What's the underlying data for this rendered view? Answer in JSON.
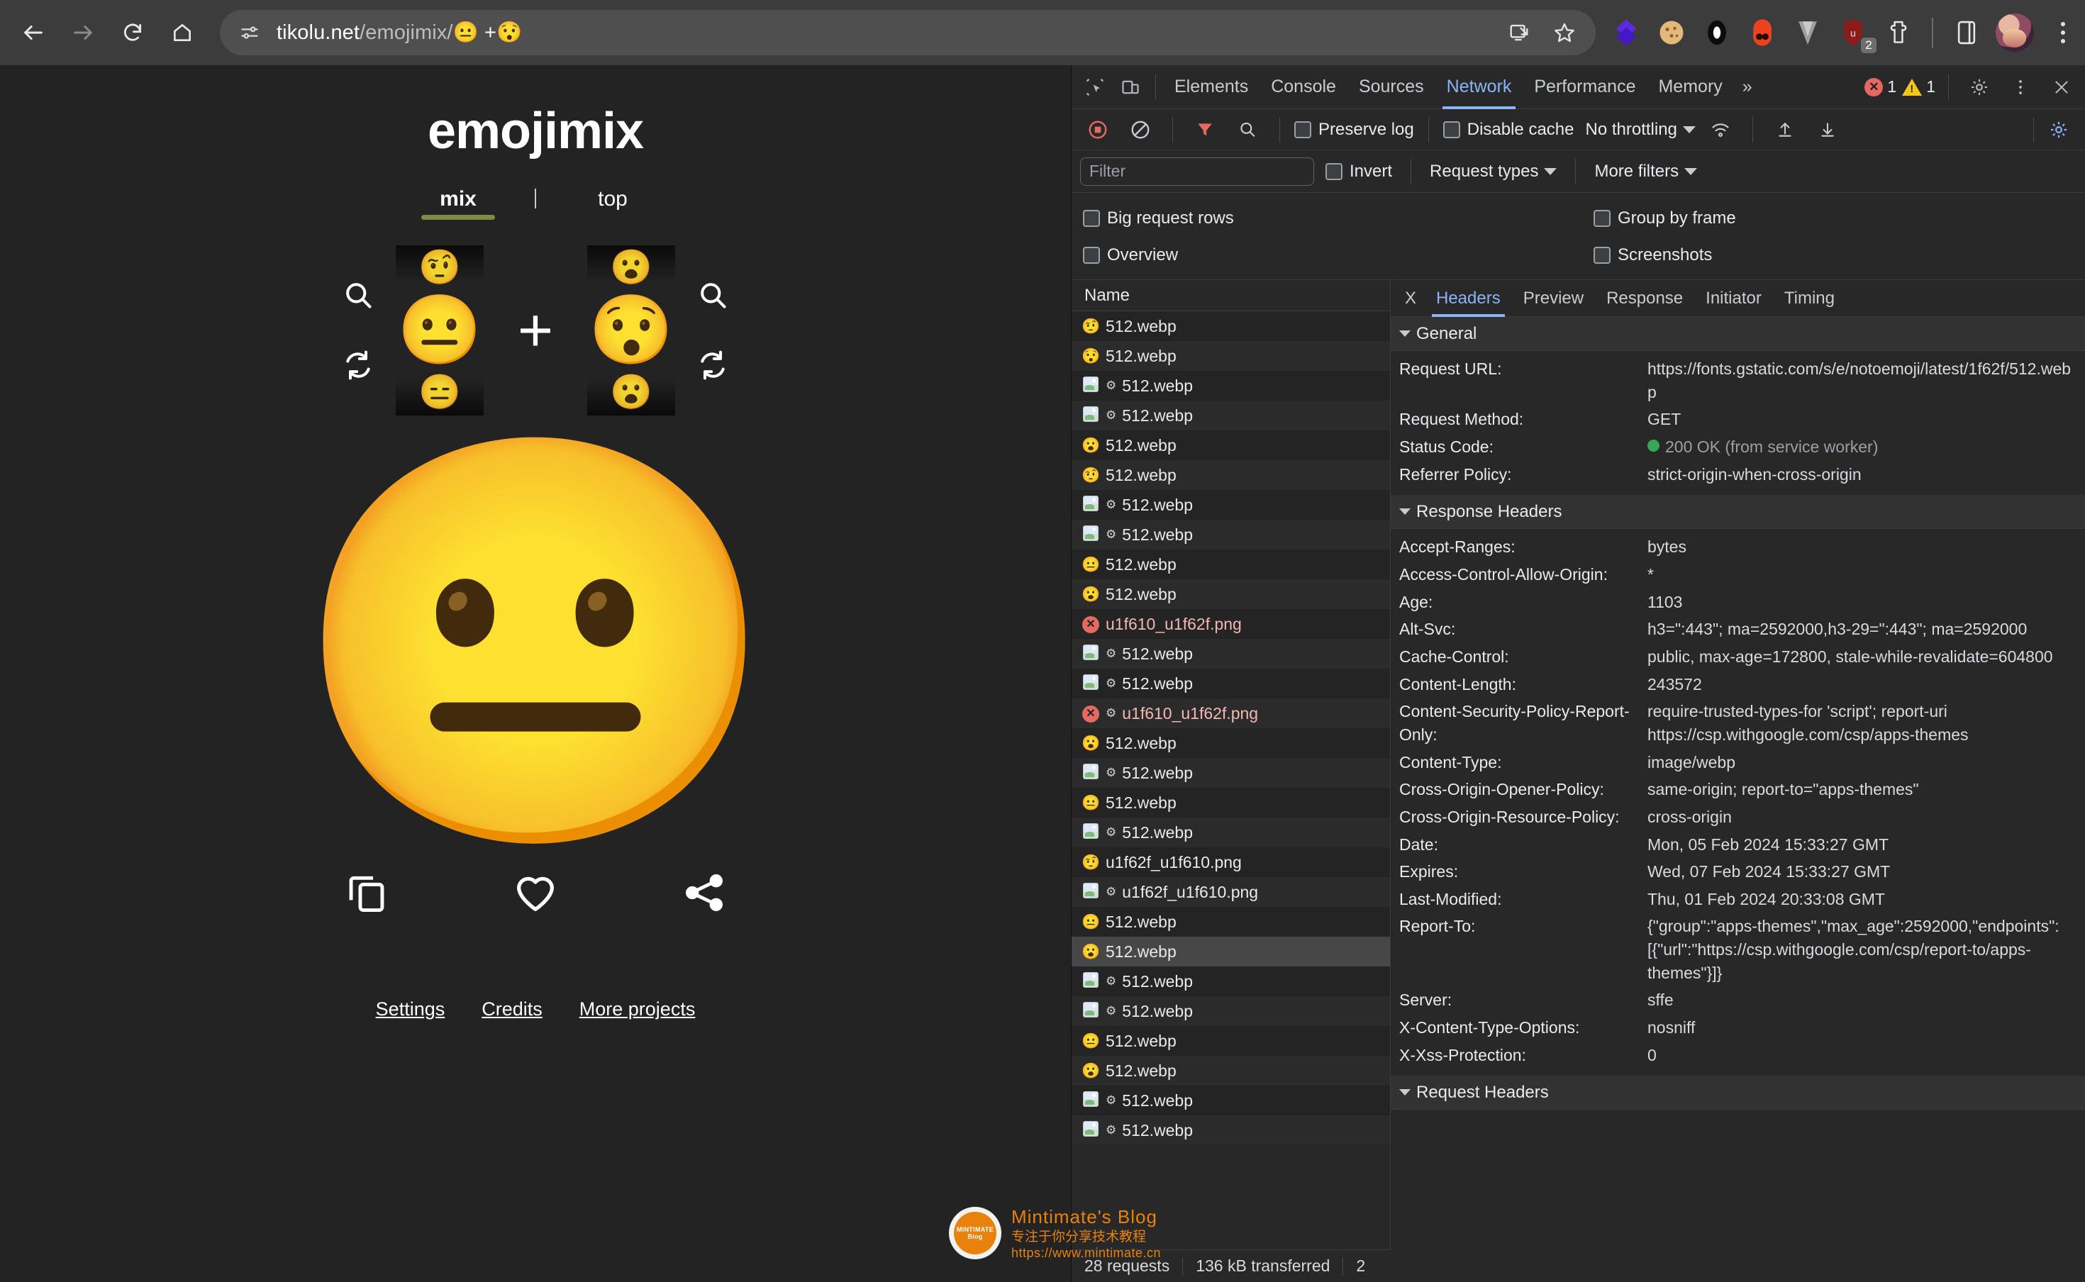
{
  "browser": {
    "back_label": "Back",
    "forward_label": "Forward",
    "reload_label": "Reload",
    "home_label": "Home",
    "site_info_label": "View site information",
    "url_prefix": "tikolu.net",
    "url_path": "/emojimix/",
    "url_emoji_a": "😐",
    "url_plus": "+",
    "url_emoji_b": "😯",
    "install_label": "Install page as app",
    "bookmark_label": "Bookmark this tab",
    "extensions": [
      {
        "name": "diamond-extension-icon",
        "badge": ""
      },
      {
        "name": "cookie-extension-icon",
        "badge": ""
      },
      {
        "name": "ring-extension-icon",
        "badge": ""
      },
      {
        "name": "red-extension-icon",
        "badge": ""
      },
      {
        "name": "v-extension-icon",
        "badge": ""
      },
      {
        "name": "shield-extension-icon",
        "badge": "2"
      },
      {
        "name": "puzzle-extensions-icon",
        "badge": ""
      }
    ],
    "side_panel_label": "Side panel",
    "profile_label": "Profile",
    "menu_label": "Customize and control Google Chrome"
  },
  "page": {
    "title": "emojimix",
    "tabs": [
      {
        "label": "mix",
        "active": true
      },
      {
        "label": "top",
        "active": false
      }
    ],
    "left_picker": {
      "search_label": "search-icon",
      "shuffle_label": "shuffle-icon",
      "prev_emoji": "🤨",
      "current_emoji": "😐",
      "next_emoji": "😑"
    },
    "plus": "+",
    "right_picker": {
      "search_label": "search-icon",
      "shuffle_label": "shuffle-icon",
      "prev_emoji": "😮",
      "current_emoji": "😯",
      "next_emoji": "😮"
    },
    "result_emoji": "😐",
    "actions": [
      {
        "name": "copy-button",
        "label": "Copy"
      },
      {
        "name": "favorite-button",
        "label": "Favorite"
      },
      {
        "name": "share-button",
        "label": "Share"
      }
    ],
    "footer_links": [
      "Settings",
      "Credits",
      "More projects"
    ]
  },
  "watermark": {
    "logo_line1": "MINTIMATE",
    "logo_line2": "Blog",
    "title": "Mintimate's Blog",
    "subtitle": "专注于你分享技术教程",
    "url": "https://www.mintimate.cn"
  },
  "devtools": {
    "inspect_label": "inspect-element-icon",
    "device_label": "device-toolbar-icon",
    "tabs": [
      {
        "label": "Elements",
        "active": false
      },
      {
        "label": "Console",
        "active": false
      },
      {
        "label": "Sources",
        "active": false
      },
      {
        "label": "Network",
        "active": true
      },
      {
        "label": "Performance",
        "active": false
      },
      {
        "label": "Memory",
        "active": false
      }
    ],
    "more_tabs": "»",
    "error_count": "1",
    "warning_count": "1",
    "settings_label": "settings-gear-icon",
    "kebab_label": "more-options-icon",
    "close_label": "close-devtools-icon",
    "network_toolbar": {
      "record_label": "record-stop-icon",
      "clear_label": "clear-icon",
      "filter_toggle_label": "filter-icon",
      "search_label": "search-icon",
      "preserve_log": "Preserve log",
      "disable_cache": "Disable cache",
      "throttling": "No throttling",
      "wifi_label": "network-conditions-icon",
      "import_label": "import-har-icon",
      "export_label": "export-har-icon",
      "gear_label": "network-settings-icon"
    },
    "filter_bar": {
      "filter_placeholder": "Filter",
      "filter_value": "",
      "invert": "Invert",
      "request_types": "Request types",
      "more_filters": "More filters"
    },
    "options": {
      "big_request_rows": "Big request rows",
      "group_by_frame": "Group by frame",
      "overview": "Overview",
      "screenshots": "Screenshots"
    },
    "request_column_header": "Name",
    "requests": [
      {
        "icon": "emoji",
        "emoji": "🤨",
        "gear": false,
        "name": "512.webp",
        "error": false,
        "selected": false
      },
      {
        "icon": "emoji",
        "emoji": "😯",
        "gear": false,
        "name": "512.webp",
        "error": false,
        "selected": false
      },
      {
        "icon": "image",
        "emoji": "",
        "gear": true,
        "name": "512.webp",
        "error": false,
        "selected": false
      },
      {
        "icon": "image",
        "emoji": "",
        "gear": true,
        "name": "512.webp",
        "error": false,
        "selected": false
      },
      {
        "icon": "emoji",
        "emoji": "😮",
        "gear": false,
        "name": "512.webp",
        "error": false,
        "selected": false
      },
      {
        "icon": "emoji",
        "emoji": "🤨",
        "gear": false,
        "name": "512.webp",
        "error": false,
        "selected": false
      },
      {
        "icon": "image",
        "emoji": "",
        "gear": true,
        "name": "512.webp",
        "error": false,
        "selected": false
      },
      {
        "icon": "image",
        "emoji": "",
        "gear": true,
        "name": "512.webp",
        "error": false,
        "selected": false
      },
      {
        "icon": "emoji",
        "emoji": "😐",
        "gear": false,
        "name": "512.webp",
        "error": false,
        "selected": false
      },
      {
        "icon": "emoji",
        "emoji": "😮",
        "gear": false,
        "name": "512.webp",
        "error": false,
        "selected": false
      },
      {
        "icon": "error",
        "emoji": "",
        "gear": false,
        "name": "u1f610_u1f62f.png",
        "error": true,
        "selected": false
      },
      {
        "icon": "image",
        "emoji": "",
        "gear": true,
        "name": "512.webp",
        "error": false,
        "selected": false
      },
      {
        "icon": "image",
        "emoji": "",
        "gear": true,
        "name": "512.webp",
        "error": false,
        "selected": false
      },
      {
        "icon": "error",
        "emoji": "",
        "gear": true,
        "name": "u1f610_u1f62f.png",
        "error": true,
        "selected": false
      },
      {
        "icon": "emoji",
        "emoji": "😮",
        "gear": false,
        "name": "512.webp",
        "error": false,
        "selected": false
      },
      {
        "icon": "image",
        "emoji": "",
        "gear": true,
        "name": "512.webp",
        "error": false,
        "selected": false
      },
      {
        "icon": "emoji",
        "emoji": "😐",
        "gear": false,
        "name": "512.webp",
        "error": false,
        "selected": false
      },
      {
        "icon": "image",
        "emoji": "",
        "gear": true,
        "name": "512.webp",
        "error": false,
        "selected": false
      },
      {
        "icon": "emoji",
        "emoji": "🤨",
        "gear": false,
        "name": "u1f62f_u1f610.png",
        "error": false,
        "selected": false
      },
      {
        "icon": "image",
        "emoji": "",
        "gear": true,
        "name": "u1f62f_u1f610.png",
        "error": false,
        "selected": false
      },
      {
        "icon": "emoji",
        "emoji": "😐",
        "gear": false,
        "name": "512.webp",
        "error": false,
        "selected": false
      },
      {
        "icon": "emoji",
        "emoji": "😮",
        "gear": false,
        "name": "512.webp",
        "error": false,
        "selected": true
      },
      {
        "icon": "image",
        "emoji": "",
        "gear": true,
        "name": "512.webp",
        "error": false,
        "selected": false
      },
      {
        "icon": "image",
        "emoji": "",
        "gear": true,
        "name": "512.webp",
        "error": false,
        "selected": false
      },
      {
        "icon": "emoji",
        "emoji": "😐",
        "gear": false,
        "name": "512.webp",
        "error": false,
        "selected": false
      },
      {
        "icon": "emoji",
        "emoji": "😮",
        "gear": false,
        "name": "512.webp",
        "error": false,
        "selected": false
      },
      {
        "icon": "image",
        "emoji": "",
        "gear": true,
        "name": "512.webp",
        "error": false,
        "selected": false
      },
      {
        "icon": "image",
        "emoji": "",
        "gear": true,
        "name": "512.webp",
        "error": false,
        "selected": false
      }
    ],
    "footer": {
      "requests": "28 requests",
      "transferred": "136 kB transferred",
      "resources": "2"
    },
    "detail": {
      "close_label": "X",
      "tabs": [
        {
          "label": "Headers",
          "active": true
        },
        {
          "label": "Preview",
          "active": false
        },
        {
          "label": "Response",
          "active": false
        },
        {
          "label": "Initiator",
          "active": false
        },
        {
          "label": "Timing",
          "active": false
        }
      ],
      "general_title": "General",
      "general": [
        {
          "key": "Request URL:",
          "value": "https://fonts.gstatic.com/s/e/notoemoji/latest/1f62f/512.webp",
          "status": false
        },
        {
          "key": "Request Method:",
          "value": "GET",
          "status": false
        },
        {
          "key": "Status Code:",
          "value": "200 OK (from service worker)",
          "status": true
        },
        {
          "key": "Referrer Policy:",
          "value": "strict-origin-when-cross-origin",
          "status": false
        }
      ],
      "response_title": "Response Headers",
      "response_headers": [
        {
          "key": "Accept-Ranges:",
          "value": "bytes"
        },
        {
          "key": "Access-Control-Allow-Origin:",
          "value": "*"
        },
        {
          "key": "Age:",
          "value": "1103"
        },
        {
          "key": "Alt-Svc:",
          "value": "h3=\":443\"; ma=2592000,h3-29=\":443\"; ma=2592000"
        },
        {
          "key": "Cache-Control:",
          "value": "public, max-age=172800, stale-while-revalidate=604800"
        },
        {
          "key": "Content-Length:",
          "value": "243572"
        },
        {
          "key": "Content-Security-Policy-Report-Only:",
          "value": "require-trusted-types-for 'script'; report-uri https://csp.withgoogle.com/csp/apps-themes"
        },
        {
          "key": "Content-Type:",
          "value": "image/webp"
        },
        {
          "key": "Cross-Origin-Opener-Policy:",
          "value": "same-origin; report-to=\"apps-themes\""
        },
        {
          "key": "Cross-Origin-Resource-Policy:",
          "value": "cross-origin"
        },
        {
          "key": "Date:",
          "value": "Mon, 05 Feb 2024 15:33:27 GMT"
        },
        {
          "key": "Expires:",
          "value": "Wed, 07 Feb 2024 15:33:27 GMT"
        },
        {
          "key": "Last-Modified:",
          "value": "Thu, 01 Feb 2024 20:33:08 GMT"
        },
        {
          "key": "Report-To:",
          "value": "{\"group\":\"apps-themes\",\"max_age\":2592000,\"endpoints\":[{\"url\":\"https://csp.withgoogle.com/csp/report-to/apps-themes\"}]}"
        },
        {
          "key": "Server:",
          "value": "sffe"
        },
        {
          "key": "X-Content-Type-Options:",
          "value": "nosniff"
        },
        {
          "key": "X-Xss-Protection:",
          "value": "0"
        }
      ],
      "request_title": "Request Headers"
    }
  }
}
